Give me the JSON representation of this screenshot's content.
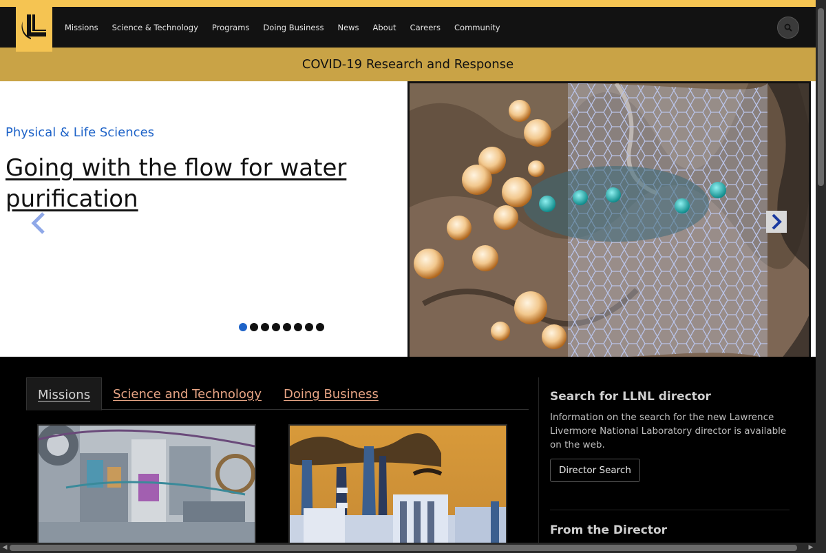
{
  "nav": {
    "logo_icon": "llnl-logo-icon",
    "links": [
      "Missions",
      "Science & Technology",
      "Programs",
      "Doing Business",
      "News",
      "About",
      "Careers",
      "Community"
    ],
    "search_icon": "search-icon"
  },
  "banner": {
    "text": "COVID-19 Research and Response"
  },
  "hero": {
    "eyebrow": "Physical & Life Sciences",
    "title": "Going with the flow for water purification",
    "slide_count": 8,
    "active_slide": 1
  },
  "tabs": [
    "Missions",
    "Science and Technology",
    "Doing Business"
  ],
  "sidebar": {
    "section1": {
      "title": "Search for LLNL director",
      "body": "Information on the search for the new Lawrence Livermore National Laboratory director is available on the web.",
      "button": "Director Search"
    },
    "section2": {
      "title": "From the Director"
    }
  },
  "colors": {
    "accent_gold": "#f5c452",
    "banner_gold": "#c9a346",
    "link_blue": "#1e63c8",
    "tab_link": "#e8a585"
  }
}
